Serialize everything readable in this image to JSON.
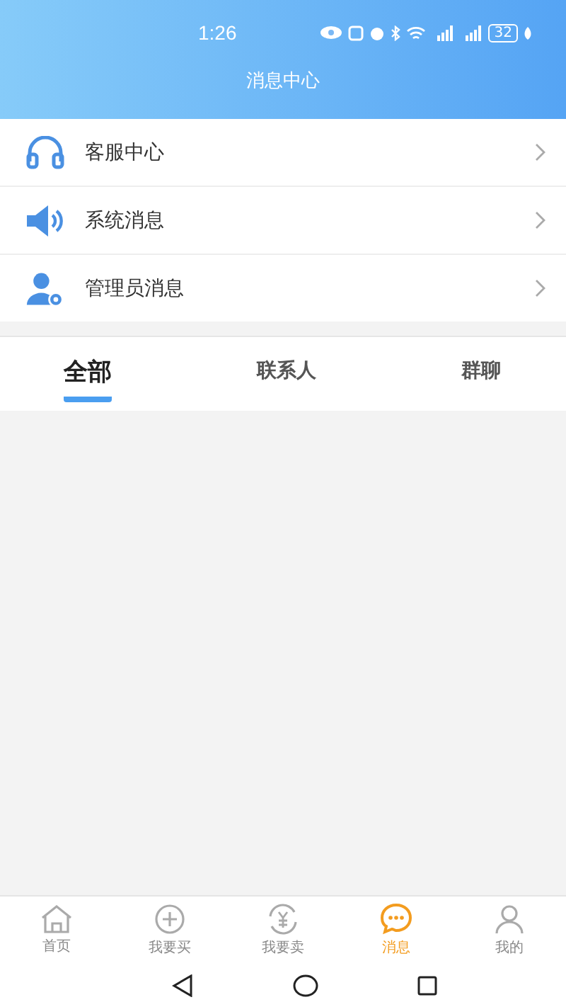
{
  "status_bar": {
    "time": "1:26",
    "battery": "32"
  },
  "header": {
    "title": "消息中心"
  },
  "menu": [
    {
      "kind": "headset",
      "label": "客服中心"
    },
    {
      "kind": "speaker",
      "label": "系统消息"
    },
    {
      "kind": "admin",
      "label": "管理员消息"
    }
  ],
  "tabs": [
    {
      "label": "全部",
      "selected": true
    },
    {
      "label": "联系人",
      "selected": false
    },
    {
      "label": "群聊",
      "selected": false
    }
  ],
  "bottom_nav": [
    {
      "kind": "home",
      "label": "首页",
      "selected": false
    },
    {
      "kind": "buy",
      "label": "我要买",
      "selected": false
    },
    {
      "kind": "sell",
      "label": "我要卖",
      "selected": false
    },
    {
      "kind": "message",
      "label": "消息",
      "selected": true
    },
    {
      "kind": "profile",
      "label": "我的",
      "selected": false
    }
  ]
}
